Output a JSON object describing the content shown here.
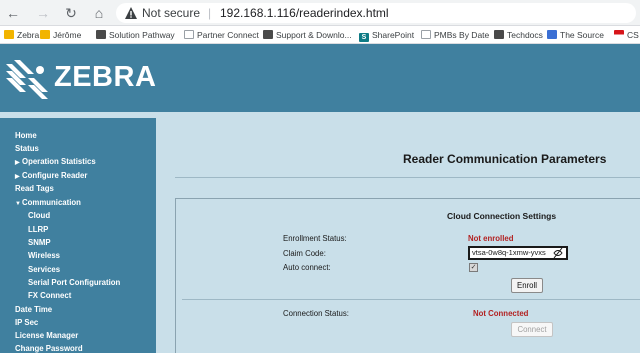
{
  "browser": {
    "security_label": "Not secure",
    "url": "192.168.1.116/readerindex.html",
    "bookmarks": [
      {
        "label": "Zebra",
        "icon": "folder-icon"
      },
      {
        "label": "Jérôme",
        "icon": "folder-icon"
      },
      {
        "label": "Solution Pathway",
        "icon": "bookmark-icon"
      },
      {
        "label": "Partner Connect",
        "icon": "page-icon"
      },
      {
        "label": "Support & Downlo...",
        "icon": "bookmark-icon"
      },
      {
        "label": "SharePoint",
        "icon": "sharepoint-icon"
      },
      {
        "label": "PMBs By Date",
        "icon": "page-icon"
      },
      {
        "label": "Techdocs",
        "icon": "bookmark-icon"
      },
      {
        "label": "The Source",
        "icon": "source-icon"
      },
      {
        "label": "CS",
        "icon": "flag-icon"
      }
    ]
  },
  "brand": {
    "name": "ZEBRA"
  },
  "sidebar": {
    "items": [
      {
        "label": "Home"
      },
      {
        "label": "Status"
      },
      {
        "label": "Operation Statistics",
        "arrow": "▶"
      },
      {
        "label": "Configure Reader",
        "arrow": "▶"
      },
      {
        "label": "Read Tags"
      },
      {
        "label": "Communication",
        "arrow": "▼"
      },
      {
        "label": "Cloud"
      },
      {
        "label": "LLRP"
      },
      {
        "label": "SNMP"
      },
      {
        "label": "Wireless"
      },
      {
        "label": "Services"
      },
      {
        "label": "Serial Port Configuration"
      },
      {
        "label": "FX Connect"
      },
      {
        "label": "Date Time"
      },
      {
        "label": "IP Sec"
      },
      {
        "label": "License Manager"
      },
      {
        "label": "Change Password"
      }
    ]
  },
  "main": {
    "title": "Reader Communication Parameters",
    "section_title": "Cloud Connection Settings",
    "enrollment_label": "Enrollment Status:",
    "enrollment_value": "Not enrolled",
    "claim_label": "Claim Code:",
    "claim_value": "vtsa-0w8q-1xmw-yvxs",
    "auto_connect_label": "Auto connect:",
    "auto_connect_checked": true,
    "enroll_button": "Enroll",
    "connection_label": "Connection Status:",
    "connection_value": "Not Connected",
    "connect_button": "Connect"
  },
  "colors": {
    "brand_blue": "#40809f",
    "content_bg": "#c9dfe9",
    "status_red": "#b22222"
  }
}
